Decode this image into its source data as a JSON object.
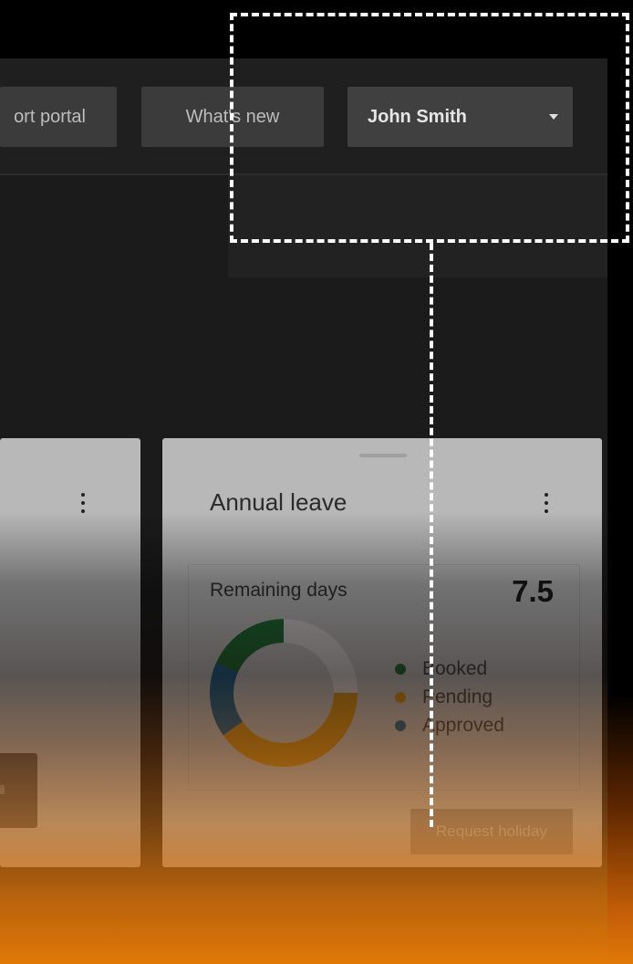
{
  "header": {
    "support_label": "ort portal",
    "whatsnew_label": "What's new",
    "user_name": "John Smith"
  },
  "annual_leave_card": {
    "title": "Annual leave",
    "remaining_label": "Remaining days",
    "remaining_value": "7.5",
    "legend": [
      {
        "label": "Booked",
        "color": "#1f6b35"
      },
      {
        "label": "Pending",
        "color": "#c48a1c"
      },
      {
        "label": "Approved",
        "color": "#1f5f86"
      }
    ],
    "request_button": "Request holiday"
  },
  "colors": {
    "booked": "#1f6b35",
    "pending": "#c48a1c",
    "approved": "#1f5f86",
    "unused": "#cfcfcf"
  }
}
